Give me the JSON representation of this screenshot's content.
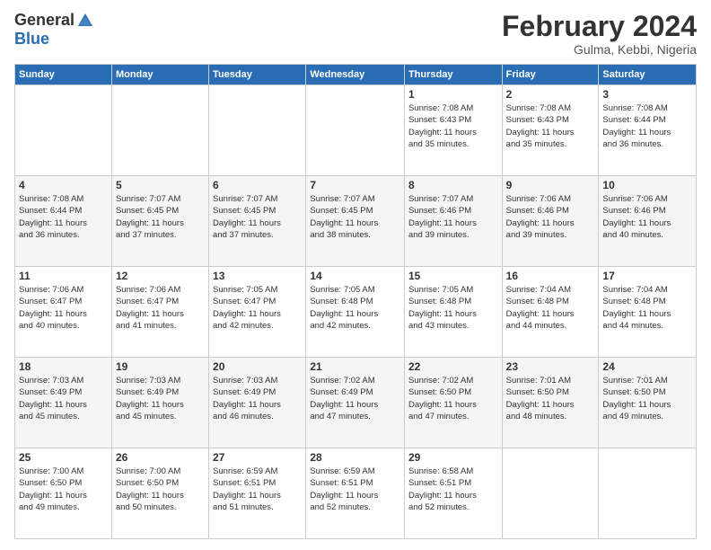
{
  "header": {
    "logo_general": "General",
    "logo_blue": "Blue",
    "month_title": "February 2024",
    "location": "Gulma, Kebbi, Nigeria"
  },
  "weekdays": [
    "Sunday",
    "Monday",
    "Tuesday",
    "Wednesday",
    "Thursday",
    "Friday",
    "Saturday"
  ],
  "weeks": [
    [
      {
        "day": "",
        "info": ""
      },
      {
        "day": "",
        "info": ""
      },
      {
        "day": "",
        "info": ""
      },
      {
        "day": "",
        "info": ""
      },
      {
        "day": "1",
        "info": "Sunrise: 7:08 AM\nSunset: 6:43 PM\nDaylight: 11 hours\nand 35 minutes."
      },
      {
        "day": "2",
        "info": "Sunrise: 7:08 AM\nSunset: 6:43 PM\nDaylight: 11 hours\nand 35 minutes."
      },
      {
        "day": "3",
        "info": "Sunrise: 7:08 AM\nSunset: 6:44 PM\nDaylight: 11 hours\nand 36 minutes."
      }
    ],
    [
      {
        "day": "4",
        "info": "Sunrise: 7:08 AM\nSunset: 6:44 PM\nDaylight: 11 hours\nand 36 minutes."
      },
      {
        "day": "5",
        "info": "Sunrise: 7:07 AM\nSunset: 6:45 PM\nDaylight: 11 hours\nand 37 minutes."
      },
      {
        "day": "6",
        "info": "Sunrise: 7:07 AM\nSunset: 6:45 PM\nDaylight: 11 hours\nand 37 minutes."
      },
      {
        "day": "7",
        "info": "Sunrise: 7:07 AM\nSunset: 6:45 PM\nDaylight: 11 hours\nand 38 minutes."
      },
      {
        "day": "8",
        "info": "Sunrise: 7:07 AM\nSunset: 6:46 PM\nDaylight: 11 hours\nand 39 minutes."
      },
      {
        "day": "9",
        "info": "Sunrise: 7:06 AM\nSunset: 6:46 PM\nDaylight: 11 hours\nand 39 minutes."
      },
      {
        "day": "10",
        "info": "Sunrise: 7:06 AM\nSunset: 6:46 PM\nDaylight: 11 hours\nand 40 minutes."
      }
    ],
    [
      {
        "day": "11",
        "info": "Sunrise: 7:06 AM\nSunset: 6:47 PM\nDaylight: 11 hours\nand 40 minutes."
      },
      {
        "day": "12",
        "info": "Sunrise: 7:06 AM\nSunset: 6:47 PM\nDaylight: 11 hours\nand 41 minutes."
      },
      {
        "day": "13",
        "info": "Sunrise: 7:05 AM\nSunset: 6:47 PM\nDaylight: 11 hours\nand 42 minutes."
      },
      {
        "day": "14",
        "info": "Sunrise: 7:05 AM\nSunset: 6:48 PM\nDaylight: 11 hours\nand 42 minutes."
      },
      {
        "day": "15",
        "info": "Sunrise: 7:05 AM\nSunset: 6:48 PM\nDaylight: 11 hours\nand 43 minutes."
      },
      {
        "day": "16",
        "info": "Sunrise: 7:04 AM\nSunset: 6:48 PM\nDaylight: 11 hours\nand 44 minutes."
      },
      {
        "day": "17",
        "info": "Sunrise: 7:04 AM\nSunset: 6:48 PM\nDaylight: 11 hours\nand 44 minutes."
      }
    ],
    [
      {
        "day": "18",
        "info": "Sunrise: 7:03 AM\nSunset: 6:49 PM\nDaylight: 11 hours\nand 45 minutes."
      },
      {
        "day": "19",
        "info": "Sunrise: 7:03 AM\nSunset: 6:49 PM\nDaylight: 11 hours\nand 45 minutes."
      },
      {
        "day": "20",
        "info": "Sunrise: 7:03 AM\nSunset: 6:49 PM\nDaylight: 11 hours\nand 46 minutes."
      },
      {
        "day": "21",
        "info": "Sunrise: 7:02 AM\nSunset: 6:49 PM\nDaylight: 11 hours\nand 47 minutes."
      },
      {
        "day": "22",
        "info": "Sunrise: 7:02 AM\nSunset: 6:50 PM\nDaylight: 11 hours\nand 47 minutes."
      },
      {
        "day": "23",
        "info": "Sunrise: 7:01 AM\nSunset: 6:50 PM\nDaylight: 11 hours\nand 48 minutes."
      },
      {
        "day": "24",
        "info": "Sunrise: 7:01 AM\nSunset: 6:50 PM\nDaylight: 11 hours\nand 49 minutes."
      }
    ],
    [
      {
        "day": "25",
        "info": "Sunrise: 7:00 AM\nSunset: 6:50 PM\nDaylight: 11 hours\nand 49 minutes."
      },
      {
        "day": "26",
        "info": "Sunrise: 7:00 AM\nSunset: 6:50 PM\nDaylight: 11 hours\nand 50 minutes."
      },
      {
        "day": "27",
        "info": "Sunrise: 6:59 AM\nSunset: 6:51 PM\nDaylight: 11 hours\nand 51 minutes."
      },
      {
        "day": "28",
        "info": "Sunrise: 6:59 AM\nSunset: 6:51 PM\nDaylight: 11 hours\nand 52 minutes."
      },
      {
        "day": "29",
        "info": "Sunrise: 6:58 AM\nSunset: 6:51 PM\nDaylight: 11 hours\nand 52 minutes."
      },
      {
        "day": "",
        "info": ""
      },
      {
        "day": "",
        "info": ""
      }
    ]
  ]
}
